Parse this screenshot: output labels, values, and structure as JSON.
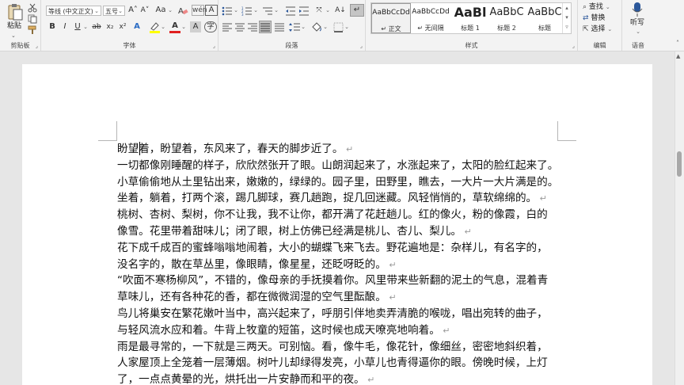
{
  "ribbon": {
    "clipboard": {
      "label": "剪贴板",
      "paste": "粘贴"
    },
    "font": {
      "label": "字体",
      "font_name": "等线 (中文正文)",
      "font_size": "五号",
      "grow": "A˄",
      "shrink": "A˅",
      "case": "Aa",
      "bold": "B",
      "italic": "I",
      "underline": "U",
      "strike": "ab",
      "subscript": "x₂",
      "superscript": "x²",
      "font_color": "A",
      "char_shade": "A"
    },
    "paragraph": {
      "label": "段落"
    },
    "styles": {
      "label": "样式",
      "items": [
        {
          "preview": "AaBbCcDd",
          "name": "↵ 正文"
        },
        {
          "preview": "AaBbCcDd",
          "name": "↵ 无间隔"
        },
        {
          "preview": "AaBl",
          "name": "标题 1"
        },
        {
          "preview": "AaBbC",
          "name": "标题 2"
        },
        {
          "preview": "AaBbC",
          "name": "标题"
        }
      ]
    },
    "editing": {
      "label": "编辑",
      "find": "查找",
      "replace": "替换",
      "select": "选择"
    },
    "voice": {
      "label": "语音",
      "dictate": "听写"
    }
  },
  "document": {
    "return_mark": "↵",
    "lines": [
      {
        "text": "盼望着，盼望着，东风来了，春天的脚步近了。",
        "mark": true
      },
      {
        "text": "一切都像刚睡醒的样子，欣欣然张开了眼。山朗润起来了，水涨起来了，太阳的脸红起来了。",
        "mark": false
      },
      {
        "text": "小草偷偷地从土里钻出来，嫩嫩的，绿绿的。园子里，田野里，瞧去，一大片一大片满是的。",
        "mark": false
      },
      {
        "text": "坐着，躺着，打两个滚，踢几脚球，赛几趟跑，捉几回迷藏。风轻悄悄的，草软绵绵的。",
        "mark": true
      },
      {
        "text": "桃树、杏树、梨树，你不让我，我不让你，都开满了花赶趟儿。红的像火，粉的像霞，白的",
        "mark": false
      },
      {
        "text": "像雪。花里带着甜味儿；闭了眼，树上仿佛已经满是桃儿、杏儿、梨儿。",
        "mark": true
      },
      {
        "text": "花下成千成百的蜜蜂嗡嗡地闹着，大小的蝴蝶飞来飞去。野花遍地是：杂样儿，有名字的，",
        "mark": false
      },
      {
        "text": "没名字的，散在草丛里，像眼睛，像星星，还眨呀眨的。",
        "mark": true
      },
      {
        "text": "“吹面不寒杨柳风”，不错的，像母亲的手抚摸着你。风里带来些新翻的泥土的气息，混着青",
        "mark": false
      },
      {
        "text": "草味儿，还有各种花的香，都在微微润湿的空气里酝酿。",
        "mark": true
      },
      {
        "text": "鸟儿将巢安在繁花嫩叶当中，高兴起来了，呼朋引伴地卖弄清脆的喉咙，唱出宛转的曲子，",
        "mark": false
      },
      {
        "text": "与轻风流水应和着。牛背上牧童的短笛，这时候也成天嘹亮地响着。",
        "mark": true
      },
      {
        "text": "雨是最寻常的，一下就是三两天。可别恼。看，像牛毛，像花针，像细丝，密密地斜织着，",
        "mark": false
      },
      {
        "text": "人家屋顶上全笼着一层薄烟。树叶儿却绿得发亮，小草儿也青得逼你的眼。傍晚时候，上灯",
        "mark": false
      },
      {
        "text": "了，一点点黄晕的光，烘托出一片安静而和平的夜。",
        "mark": true
      }
    ]
  },
  "colors": {
    "accent": "#2b579a",
    "font_color_bar": "#e02020",
    "highlight_bar": "#ffff00"
  }
}
